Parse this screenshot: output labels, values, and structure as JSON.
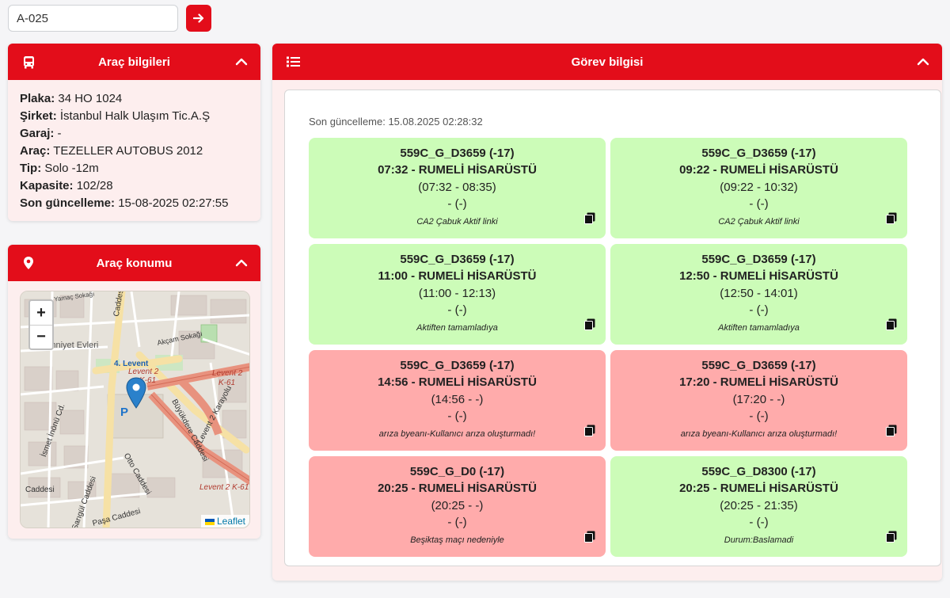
{
  "search": {
    "value": "A-025"
  },
  "vehicle_panel": {
    "title": "Araç bilgileri",
    "rows": [
      {
        "label": "Plaka:",
        "value": "34 HO 1024"
      },
      {
        "label": "Şirket:",
        "value": "İstanbul Halk Ulaşım Tic.A.Ş"
      },
      {
        "label": "Garaj:",
        "value": "-"
      },
      {
        "label": "Araç:",
        "value": "TEZELLER AUTOBUS 2012"
      },
      {
        "label": "Tip:",
        "value": "Solo -12m"
      },
      {
        "label": "Kapasite:",
        "value": "102/28"
      },
      {
        "label": "Son güncelleme:",
        "value": "15-08-2025 02:27:55"
      }
    ]
  },
  "location_panel": {
    "title": "Araç konumu",
    "zoom_in": "+",
    "zoom_out": "−",
    "attribution": "Leaflet",
    "map_labels": {
      "yamac": "Yamaç Sokağı",
      "emniyet": "Emniyet Evleri",
      "akcam": "Akçam Sokağı",
      "levent4": "4. Levent",
      "levent2a": "Levent 2",
      "k61a": "K-61",
      "levent2b": "Levent 2",
      "k61b": "K-61",
      "buyukdere": "Büyükdere Caddesi",
      "levent2c": "Levent 2 K-61",
      "karayolu": "Levent 2 Karayolu",
      "ismet": "İsmet İnönü Cd.",
      "otto": "Otto Caddesi",
      "caddesi1": "Caddesi",
      "caddesi2": "Caddesi",
      "sarigul": "Sarıgül Caddesi",
      "pasa": "Paşa Caddesi",
      "parking": "P"
    }
  },
  "tasks_panel": {
    "title": "Görev bilgisi",
    "last_update": "Son güncelleme: 15.08.2025 02:28:32",
    "cards": [
      {
        "status": "ok",
        "l1": "559C_G_D3659 (-17)",
        "l2": "07:32 - RUMELİ HİSARÜSTÜ",
        "l3": "(07:32 - 08:35)",
        "l4": "- (-)",
        "note": "CA2 Çabuk Aktif linki"
      },
      {
        "status": "ok",
        "l1": "559C_G_D3659 (-17)",
        "l2": "09:22 - RUMELİ HİSARÜSTÜ",
        "l3": "(09:22 - 10:32)",
        "l4": "- (-)",
        "note": "CA2 Çabuk Aktif linki"
      },
      {
        "status": "ok",
        "l1": "559C_G_D3659 (-17)",
        "l2": "11:00 - RUMELİ HİSARÜSTÜ",
        "l3": "(11:00 - 12:13)",
        "l4": "- (-)",
        "note": "Aktiften tamamladıya"
      },
      {
        "status": "ok",
        "l1": "559C_G_D3659 (-17)",
        "l2": "12:50 - RUMELİ HİSARÜSTÜ",
        "l3": "(12:50 - 14:01)",
        "l4": "- (-)",
        "note": "Aktiften tamamladıya"
      },
      {
        "status": "fail",
        "l1": "559C_G_D3659 (-17)",
        "l2": "14:56 - RUMELİ HİSARÜSTÜ",
        "l3": "(14:56 - -)",
        "l4": "- (-)",
        "note": "arıza byeanı-Kullanıcı arıza oluşturmadı!"
      },
      {
        "status": "fail",
        "l1": "559C_G_D3659 (-17)",
        "l2": "17:20 - RUMELİ HİSARÜSTÜ",
        "l3": "(17:20 - -)",
        "l4": "- (-)",
        "note": "arıza byeanı-Kullanıcı arıza oluşturmadı!"
      },
      {
        "status": "fail",
        "l1": "559C_G_D0 (-17)",
        "l2": "20:25 - RUMELİ HİSARÜSTÜ",
        "l3": "(20:25 - -)",
        "l4": "- (-)",
        "note": "Beşiktaş maçı nedeniyle"
      },
      {
        "status": "ok",
        "l1": "559C_G_D8300 (-17)",
        "l2": "20:25 - RUMELİ HİSARÜSTÜ",
        "l3": "(20:25 - 21:35)",
        "l4": "- (-)",
        "note": "Durum:Baslamadi"
      }
    ]
  },
  "colors": {
    "accent": "#e30d1a",
    "ok": "#ccfcb8",
    "fail": "#ffabab",
    "panel_bg": "#fdeeee"
  },
  "icons": [
    "arrow-right-icon",
    "bus-icon",
    "chevron-up-icon",
    "map-pin-icon",
    "list-icon",
    "copy-icon",
    "ukraine-flag-icon"
  ]
}
